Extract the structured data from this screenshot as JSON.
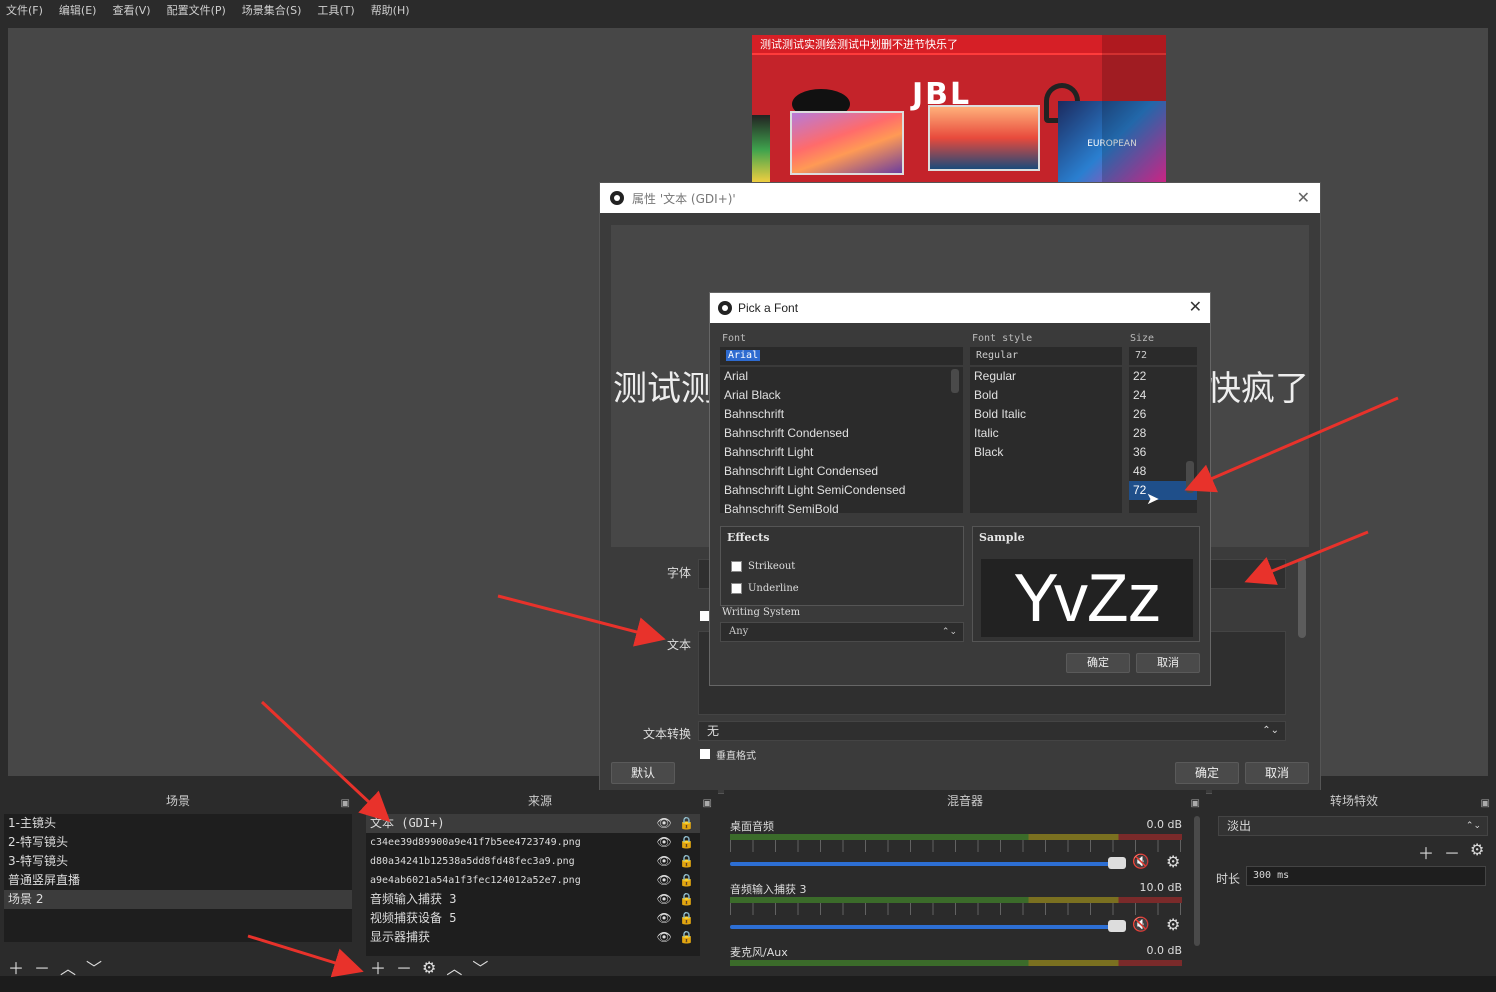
{
  "menu": [
    "文件(F)",
    "编辑(E)",
    "查看(V)",
    "配置文件(P)",
    "场景集合(S)",
    "工具(T)",
    "帮助(H)"
  ],
  "banner": {
    "ticker": "测试测试实测绘测试中划删不进节快乐了",
    "brand": "JBL",
    "tv3_label": "EUROPEAN"
  },
  "properties": {
    "title": "属性 '文本 (GDI+)'",
    "preview_left": "测试测",
    "preview_right": "快疯了",
    "font_label": "字体",
    "text_label": "文本",
    "transform_label": "文本转换",
    "transform_value": "无",
    "vertical_label": "垂直格式",
    "default_btn": "默认",
    "ok_btn": "确定",
    "cancel_btn": "取消"
  },
  "font_dialog": {
    "title": "Pick a Font",
    "font_header": "Font",
    "style_header": "Font style",
    "size_header": "Size",
    "font_value": "Arial",
    "style_value": "Regular",
    "size_value": "72",
    "fonts": [
      "Arial",
      "Arial Black",
      "Bahnschrift",
      "Bahnschrift Condensed",
      "Bahnschrift Light",
      "Bahnschrift Light Condensed",
      "Bahnschrift Light SemiCondensed",
      "Bahnschrift SemiBold"
    ],
    "styles": [
      "Regular",
      "Bold",
      "Bold Italic",
      "Italic",
      "Black"
    ],
    "sizes": [
      "22",
      "24",
      "26",
      "28",
      "36",
      "48",
      "72"
    ],
    "effects_title": "Effects",
    "strikeout": "Strikeout",
    "underline": "Underline",
    "writing_system_label": "Writing System",
    "writing_system_value": "Any",
    "sample_title": "Sample",
    "sample_text": "YvZz",
    "ok": "确定",
    "cancel": "取消"
  },
  "scenes": {
    "header": "场景",
    "items": [
      "1-主镜头",
      "2-特写镜头",
      "3-特写镜头",
      "普通竖屏直播",
      "场景 2"
    ]
  },
  "sources": {
    "header": "来源",
    "items": [
      "文本 (GDI+)",
      "c34ee39d89900a9e41f7b5ee4723749.png",
      "d80a34241b12538a5dd8fd48fec3a9.png",
      "a9e4ab6021a54a1f3fec124012a52e7.png",
      "音频输入捕获 3",
      "视频捕获设备 5",
      "显示器捕获"
    ]
  },
  "mixer": {
    "header": "混音器",
    "channels": [
      {
        "name": "桌面音频",
        "db": "0.0 dB"
      },
      {
        "name": "音频输入捕获 3",
        "db": "10.0 dB"
      },
      {
        "name": "麦克风/Aux",
        "db": "0.0 dB"
      }
    ]
  },
  "transitions": {
    "header": "转场特效",
    "value": "淡出",
    "duration_label": "时长",
    "duration_value": "300 ms"
  },
  "colors": {
    "annotation_arrow": "#e8322b",
    "selection": "#1f4f8a",
    "slider": "#2d6fd4"
  }
}
